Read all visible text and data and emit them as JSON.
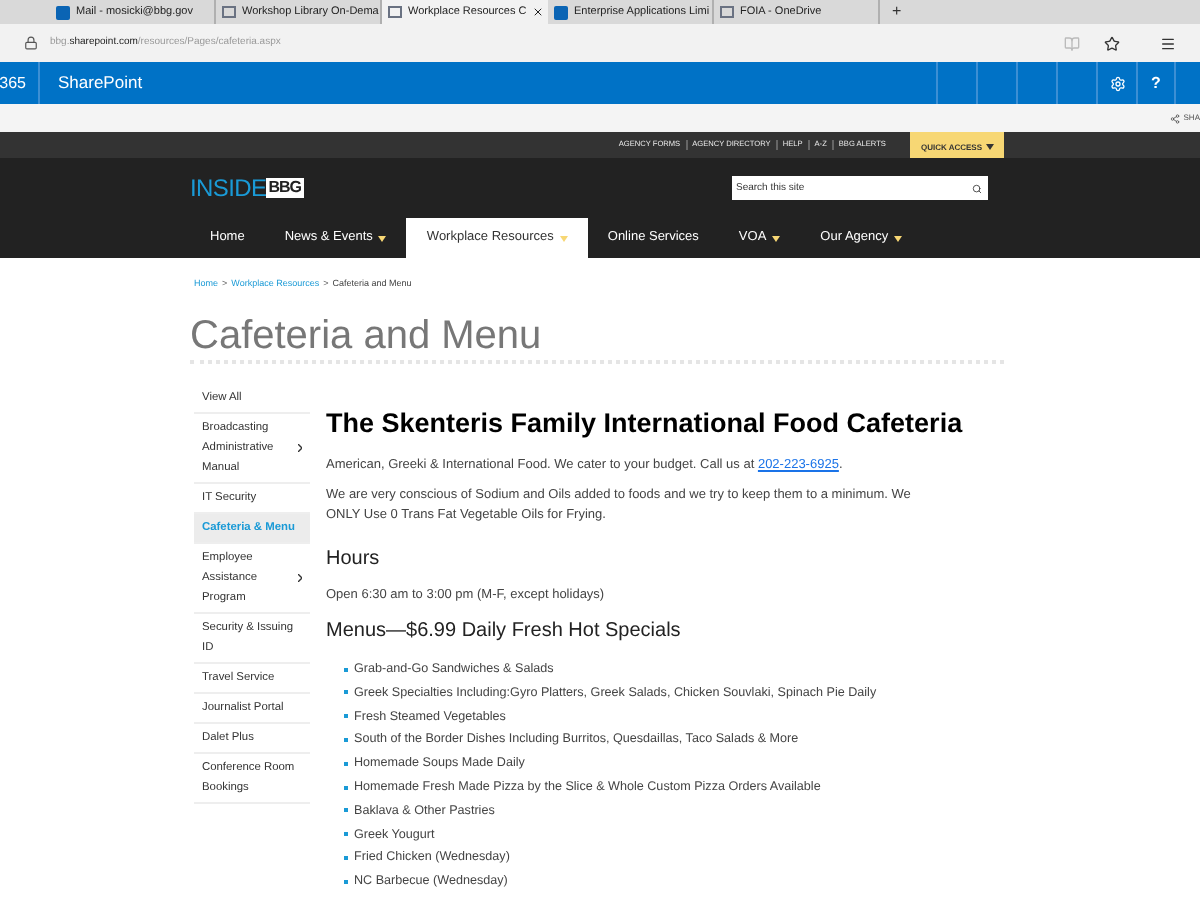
{
  "browser": {
    "tabs": [
      {
        "title": "Mail - mosicki@bbg.gov",
        "kind": "outlook",
        "selected": false
      },
      {
        "title": "Workshop Library On-Dema",
        "kind": "page",
        "selected": false
      },
      {
        "title": "Workplace Resources C",
        "kind": "page",
        "selected": true
      },
      {
        "title": "Enterprise Applications Limi",
        "kind": "outlook",
        "selected": false
      },
      {
        "title": "FOIA - OneDrive",
        "kind": "page",
        "selected": false
      }
    ],
    "new_tab": "+",
    "address": {
      "subdomain": "bbg.",
      "domain": "sharepoint.com",
      "path": "/resources/Pages/cafeteria.aspx"
    }
  },
  "suite_bar": {
    "app_prefix": "365",
    "title": "SharePoint",
    "help": "?"
  },
  "ribbon": {
    "share": "SHA"
  },
  "utility_links": [
    "AGENCY FORMS",
    "AGENCY DIRECTORY",
    "HELP",
    "A-Z",
    "BBG ALERTS"
  ],
  "quick_access": "QUICK ACCESS",
  "logo": {
    "inside": "INSIDE",
    "mark": "BBG"
  },
  "search": {
    "placeholder": "Search this site"
  },
  "nav": [
    {
      "label": "Home",
      "selected": false,
      "has_menu": false
    },
    {
      "label": "News & Events",
      "selected": false,
      "has_menu": true
    },
    {
      "label": "Workplace Resources",
      "selected": true,
      "has_menu": true
    },
    {
      "label": "Online Services",
      "selected": false,
      "has_menu": false
    },
    {
      "label": "VOA",
      "selected": false,
      "has_menu": true
    },
    {
      "label": "Our Agency",
      "selected": false,
      "has_menu": true
    }
  ],
  "breadcrumb": [
    {
      "label": "Home",
      "link": true
    },
    {
      "label": "Workplace Resources",
      "link": true
    },
    {
      "label": "Cafeteria and Menu",
      "link": false
    }
  ],
  "breadcrumb_separator": ">",
  "page_title": "Cafeteria and Menu",
  "sidebar": [
    {
      "label": "View All",
      "selected": false,
      "has_children": false
    },
    {
      "label": "Broadcasting Administrative Manual",
      "selected": false,
      "has_children": true
    },
    {
      "label": "IT Security",
      "selected": false,
      "has_children": false
    },
    {
      "label": "Cafeteria & Menu",
      "selected": true,
      "has_children": false
    },
    {
      "label": "Employee Assistance Program",
      "selected": false,
      "has_children": true
    },
    {
      "label": "Security & Issuing ID",
      "selected": false,
      "has_children": false
    },
    {
      "label": "Travel Service",
      "selected": false,
      "has_children": false
    },
    {
      "label": "Journalist Portal",
      "selected": false,
      "has_children": false
    },
    {
      "label": "Dalet Plus",
      "selected": false,
      "has_children": false
    },
    {
      "label": "Conference Room Bookings",
      "selected": false,
      "has_children": false
    }
  ],
  "article": {
    "heading": "The Skenteris Family International Food Cafeteria",
    "intro": "American, Greeki & International Food. We cater to your budget. Call us at",
    "phone": "202-223-6925",
    "intro_end": ".",
    "note": "We are very conscious of Sodium and Oils added to foods and we try to keep them to a minimum. We ONLY Use 0 Trans Fat Vegetable Oils for Frying.",
    "hours_heading": "Hours",
    "hours": "Open 6:30 am to 3:00 pm (M-F, except holidays)",
    "menu_heading": "Menus—$6.99 Daily Fresh Hot Specials",
    "menu_items": [
      "Grab-and-Go Sandwiches & Salads",
      "Greek Specialties Including:Gyro Platters, Greek Salads, Chicken Souvlaki, Spinach Pie Daily",
      "Fresh Steamed Vegetables",
      "South of the Border Dishes Including Burritos, Quesdaillas, Taco Salads & More",
      "Homemade Soups Made Daily",
      "Homemade Fresh Made Pizza by the Slice & Whole Custom Pizza Orders Available",
      "Baklava & Other Pastries",
      "Greek Yougurt",
      "Fried Chicken (Wednesday)",
      "NC Barbecue (Wednesday)"
    ]
  }
}
